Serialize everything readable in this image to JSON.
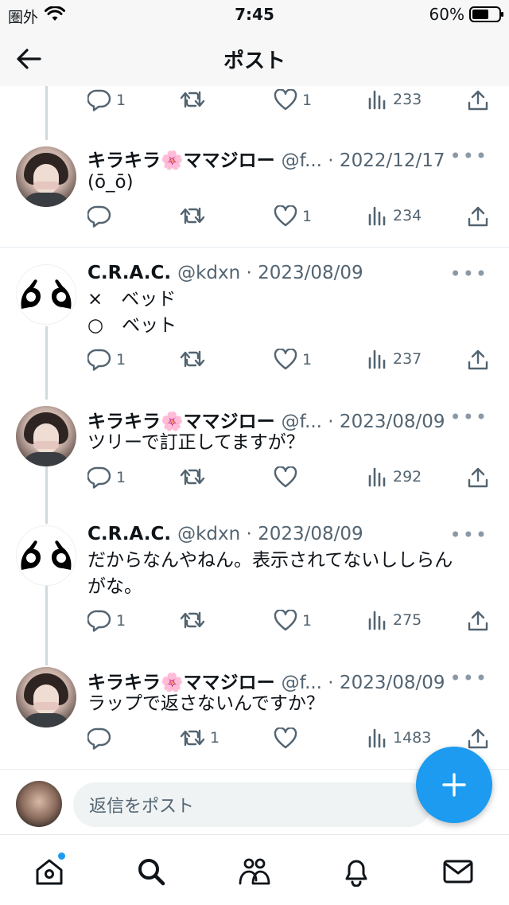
{
  "status_bar": {
    "carrier": "圏外",
    "time": "7:45",
    "battery": "60%"
  },
  "header": {
    "title": "ポスト"
  },
  "posts": [
    {
      "author": "",
      "handle_date": "",
      "text": "",
      "stats": {
        "replies": "1",
        "retweets": "",
        "likes": "1",
        "views": "233"
      }
    },
    {
      "author": "キラキラ🌸ママジロー",
      "handle_date": "@f... · 2022/12/17",
      "text": "(ō_ō)",
      "stats": {
        "replies": "",
        "retweets": "",
        "likes": "1",
        "views": "234"
      }
    },
    {
      "author": "C.R.A.C.",
      "handle_date": "@kdxn · 2023/08/09",
      "text_lines": [
        "×　ベッド",
        "○　ベット"
      ],
      "stats": {
        "replies": "1",
        "retweets": "",
        "likes": "1",
        "views": "237"
      }
    },
    {
      "author": "キラキラ🌸ママジロー",
      "handle_date": "@f... · 2023/08/09",
      "text": "ツリーで訂正してますが？",
      "stats": {
        "replies": "1",
        "retweets": "",
        "likes": "",
        "views": "292"
      }
    },
    {
      "author": "C.R.A.C.",
      "handle_date": "@kdxn · 2023/08/09",
      "text_lines": [
        "だからなんやねん。表示されてないししらん",
        "がな。"
      ],
      "stats": {
        "replies": "1",
        "retweets": "",
        "likes": "1",
        "views": "275"
      }
    },
    {
      "author": "キラキラ🌸ママジロー",
      "handle_date": "@f... · 2023/08/09",
      "text": "ラップで返さないんですか？",
      "stats": {
        "replies": "",
        "retweets": "1",
        "likes": "",
        "views": "1483"
      }
    }
  ],
  "more_label": "•••",
  "reply": {
    "placeholder": "返信をポスト"
  },
  "nav": [
    "home-icon",
    "search-icon",
    "communities-icon",
    "notifications-icon",
    "messages-icon"
  ],
  "colors": {
    "accent": "#1d9bf0",
    "muted": "#536471",
    "divider": "#e6ecf0"
  }
}
